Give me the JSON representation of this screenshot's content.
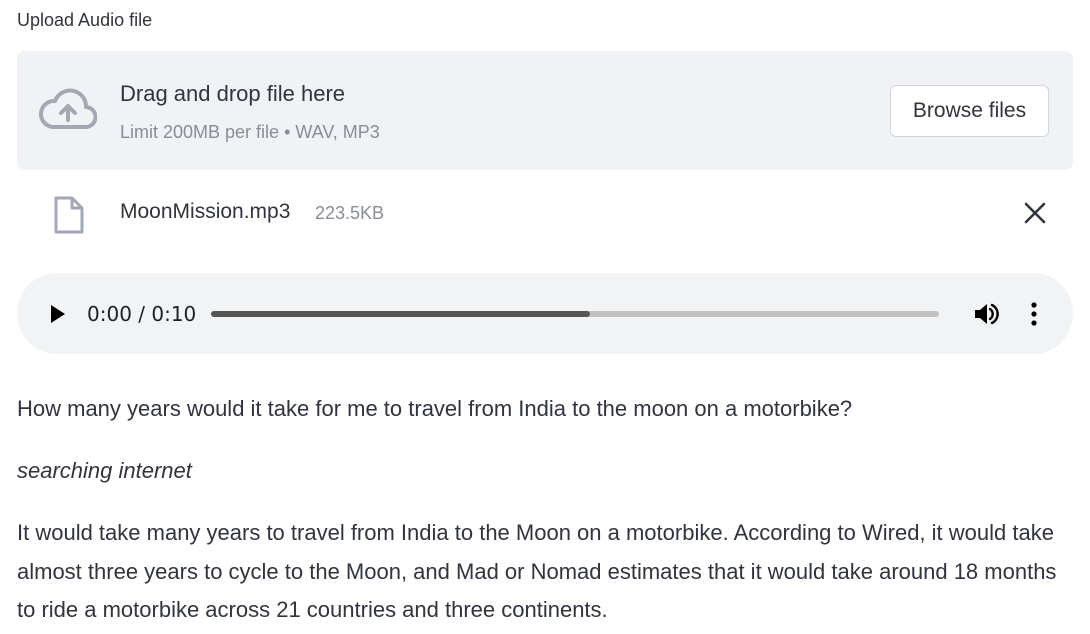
{
  "uploader": {
    "label": "Upload Audio file",
    "drop_title": "Drag and drop file here",
    "drop_subtitle": "Limit 200MB per file • WAV, MP3",
    "browse_label": "Browse files",
    "upload_icon": "cloud-upload-icon"
  },
  "file": {
    "name": "MoonMission.mp3",
    "size": "223.5KB",
    "icon": "file-icon",
    "remove_icon": "close-icon"
  },
  "player": {
    "time": "0:00 / 0:10",
    "progress": 0.52,
    "play_icon": "play-icon",
    "volume_icon": "volume-icon",
    "more_icon": "more-vertical-icon"
  },
  "chat": {
    "question": "How many years would it take for me to travel from India to the moon on a motorbike?",
    "status": "searching internet",
    "answer": "It would take many years to travel from India to the Moon on a motorbike. According to Wired, it would take almost three years to cycle to the Moon, and Mad or Nomad estimates that it would take around 18 months to ride a motorbike across 21 countries and three continents."
  }
}
